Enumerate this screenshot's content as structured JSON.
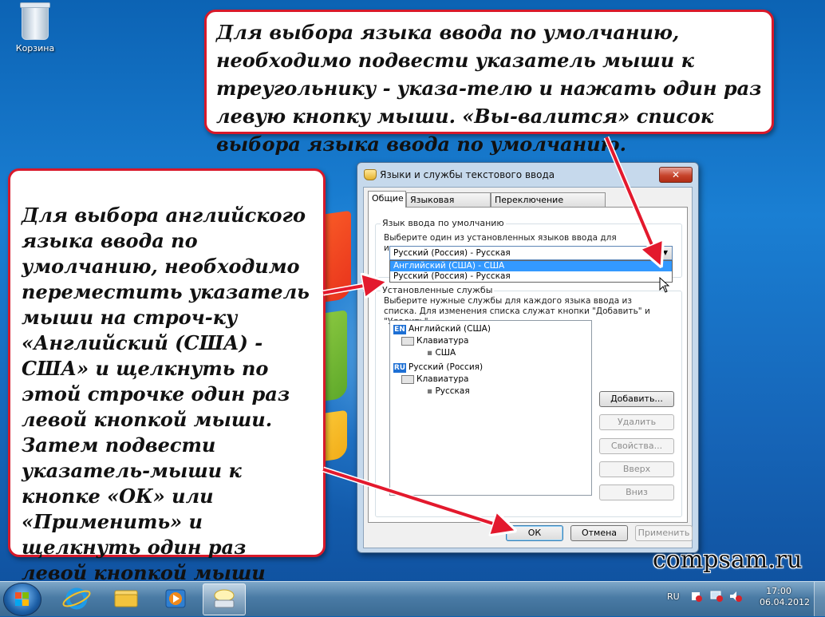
{
  "desktop": {
    "recycle_bin_label": "Корзина",
    "watermark": "compsam.ru"
  },
  "callouts": {
    "top_text": "Для выбора языка ввода по умолчанию, необходимо подвести указатель мыши к треугольнику - указа-телю и нажать один раз левую кнопку мыши. «Вы-валится» список выбора языка ввода по умолчанию.",
    "left_text": "Для выбора английского языка ввода по умолчанию, необходимо переместить указатель мыши на строч-ку «Английский (США) - США» и щелкнуть по этой строчке один раз левой кнопкой мыши.\nЗатем подвести указатель-мыши к кнопке «ОК» или «Применить» и щелкнуть один раз левой кнопкой мыши"
  },
  "dialog": {
    "title": "Языки и службы текстового ввода",
    "close_label": "✕",
    "tabs": [
      {
        "label": "Общие"
      },
      {
        "label": "Языковая панель"
      },
      {
        "label": "Переключение клавиатуры"
      }
    ],
    "default_group": {
      "label": "Язык ввода по умолчанию",
      "description": "Выберите один из установленных языков ввода для использования по умолчанию.",
      "selected": "Русский (Россия) - Русская",
      "options": [
        "Английский (США) - США",
        "Русский (Россия) - Русская"
      ]
    },
    "services_group": {
      "label": "Установленные службы",
      "description": "Выберите нужные службы для каждого языка ввода из списка. Для изменения списка служат кнопки \"Добавить\" и \"Удалить\"."
    },
    "tree": [
      {
        "badge": "EN",
        "language": "Английский (США)",
        "category": "Клавиатура",
        "layout": "США"
      },
      {
        "badge": "RU",
        "language": "Русский (Россия)",
        "category": "Клавиатура",
        "layout": "Русская"
      }
    ],
    "side_buttons": {
      "add": "Добавить...",
      "remove": "Удалить",
      "properties": "Свойства...",
      "up": "Вверх",
      "down": "Вниз"
    },
    "footer_buttons": {
      "ok": "ОК",
      "cancel": "Отмена",
      "apply": "Применить"
    }
  },
  "taskbar": {
    "language": "RU",
    "time": "17:00",
    "date": "06.04.2012"
  }
}
